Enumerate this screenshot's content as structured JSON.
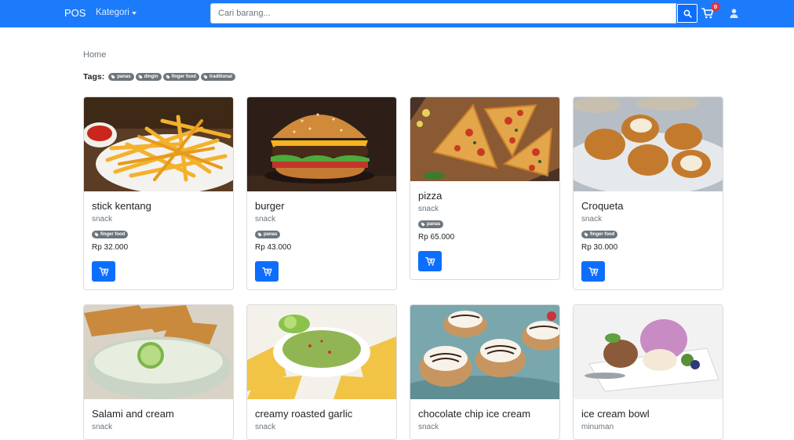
{
  "navbar": {
    "brand": "POS",
    "kategori_label": "Kategori",
    "search_placeholder": "Cari barang...",
    "cart_count": "0",
    "accent_color": "#1c7bfb"
  },
  "breadcrumb": {
    "home": "Home"
  },
  "tags": {
    "label": "Tags:",
    "items": [
      "panas",
      "dingin",
      "finger food",
      "traditional"
    ]
  },
  "products": [
    {
      "name": "stick kentang",
      "category": "snack",
      "tag": "finger food",
      "price": "Rp 32.000"
    },
    {
      "name": "burger",
      "category": "snack",
      "tag": "panas",
      "price": "Rp 43.000"
    },
    {
      "name": "pizza",
      "category": "snack",
      "tag": "panas",
      "price": "Rp 65.000"
    },
    {
      "name": "Croqueta",
      "category": "snack",
      "tag": "finger food",
      "price": "Rp 30.000"
    },
    {
      "name": "Salami and cream",
      "category": "snack"
    },
    {
      "name": "creamy roasted garlic",
      "category": "snack"
    },
    {
      "name": "chocolate chip ice cream",
      "category": "snack"
    },
    {
      "name": "ice cream bowl",
      "category": "minuman"
    }
  ]
}
